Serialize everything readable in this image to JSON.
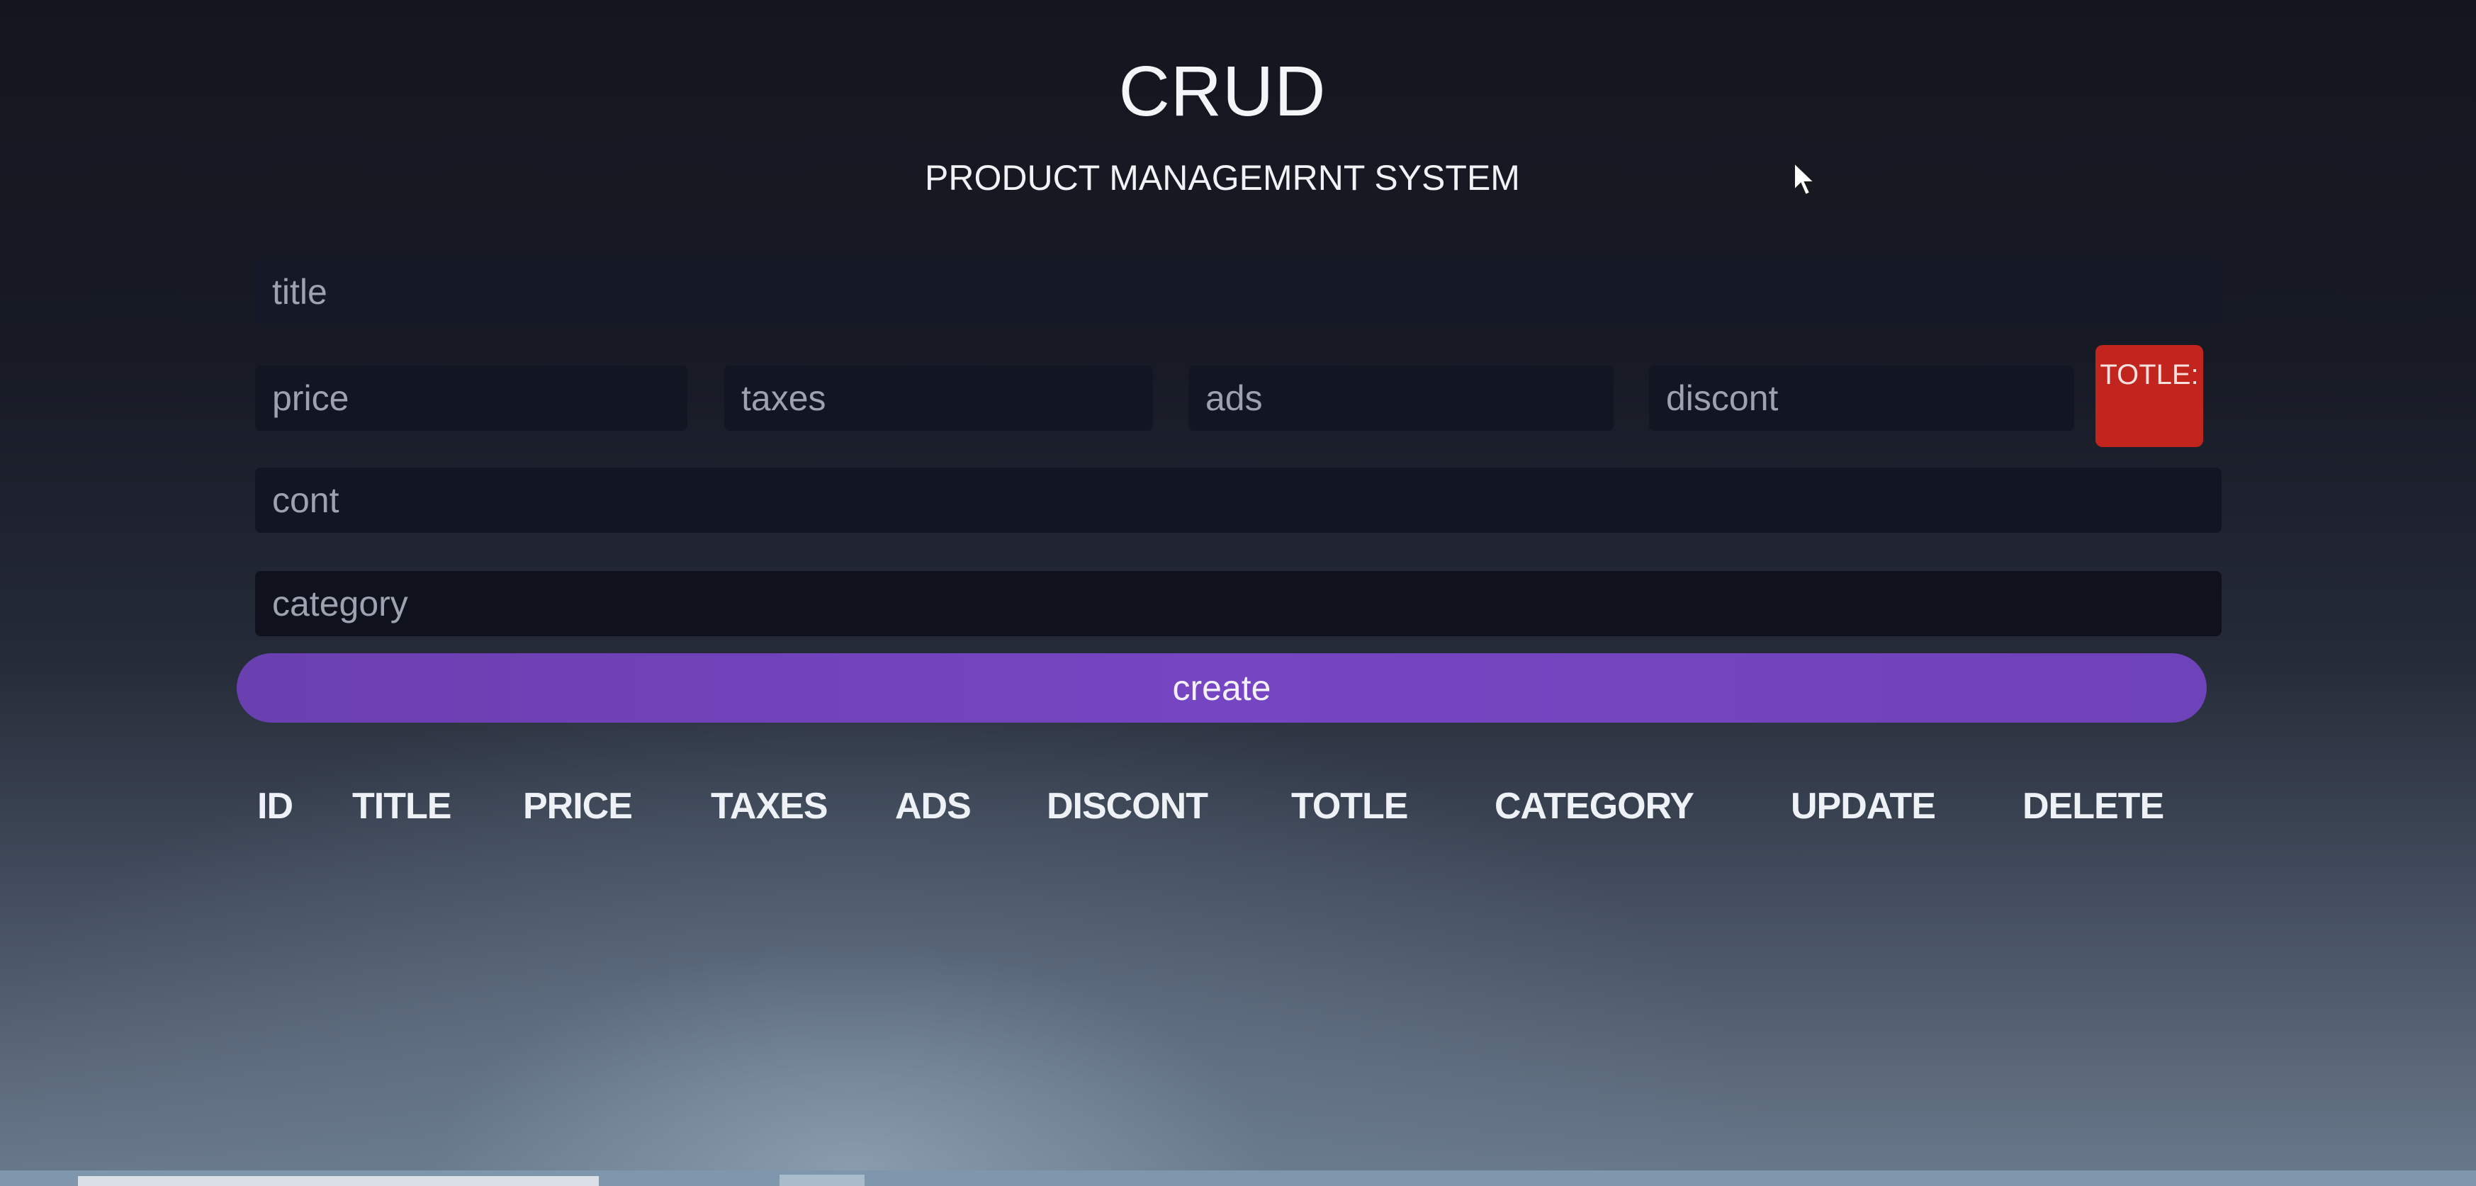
{
  "header": {
    "title": "CRUD",
    "subtitle": "PRODUCT MANAGEMRNT SYSTEM"
  },
  "form": {
    "title_placeholder": "title",
    "price_placeholder": "price",
    "taxes_placeholder": "taxes",
    "ads_placeholder": "ads",
    "discount_placeholder": "discont",
    "total_label": "TOTLE:",
    "count_placeholder": "cont",
    "category_placeholder": "category",
    "create_label": "create"
  },
  "table": {
    "columns": [
      "ID",
      "TITLE",
      "PRICE",
      "TAXES",
      "ADS",
      "DISCONT",
      "TOTLE",
      "CATEGORY",
      "UPDATE",
      "DELETE"
    ]
  },
  "colors": {
    "total_badge": "#c1251d",
    "create_button": "#7645c2",
    "input_background": "#121522"
  }
}
